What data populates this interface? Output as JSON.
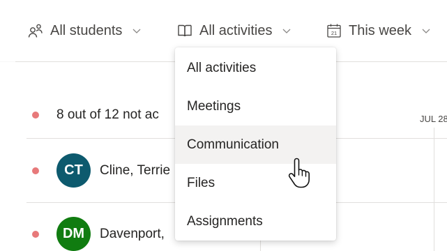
{
  "filters": {
    "students": {
      "label": "All students",
      "icon": "people-icon"
    },
    "activities": {
      "label": "All activities",
      "icon": "book-icon"
    },
    "week": {
      "label": "This week",
      "icon": "calendar-icon",
      "calendar_day": "21"
    }
  },
  "summary": {
    "text": "8 out of 12 not ac"
  },
  "timeline": {
    "date_label": "JUL 28"
  },
  "students": [
    {
      "initials": "CT",
      "name": "Cline, Terrie",
      "avatar_color": "#0d5a6e"
    },
    {
      "initials": "DM",
      "name": "Davenport, ",
      "avatar_color": "#107c10"
    }
  ],
  "dropdown": {
    "items": [
      {
        "label": "All activities"
      },
      {
        "label": "Meetings"
      },
      {
        "label": "Communication",
        "hovered": true
      },
      {
        "label": "Files"
      },
      {
        "label": "Assignments"
      }
    ]
  },
  "colors": {
    "status_dot": "#e7797a",
    "hover_bg": "#f3f2f1",
    "divider": "#e1dfdd"
  }
}
